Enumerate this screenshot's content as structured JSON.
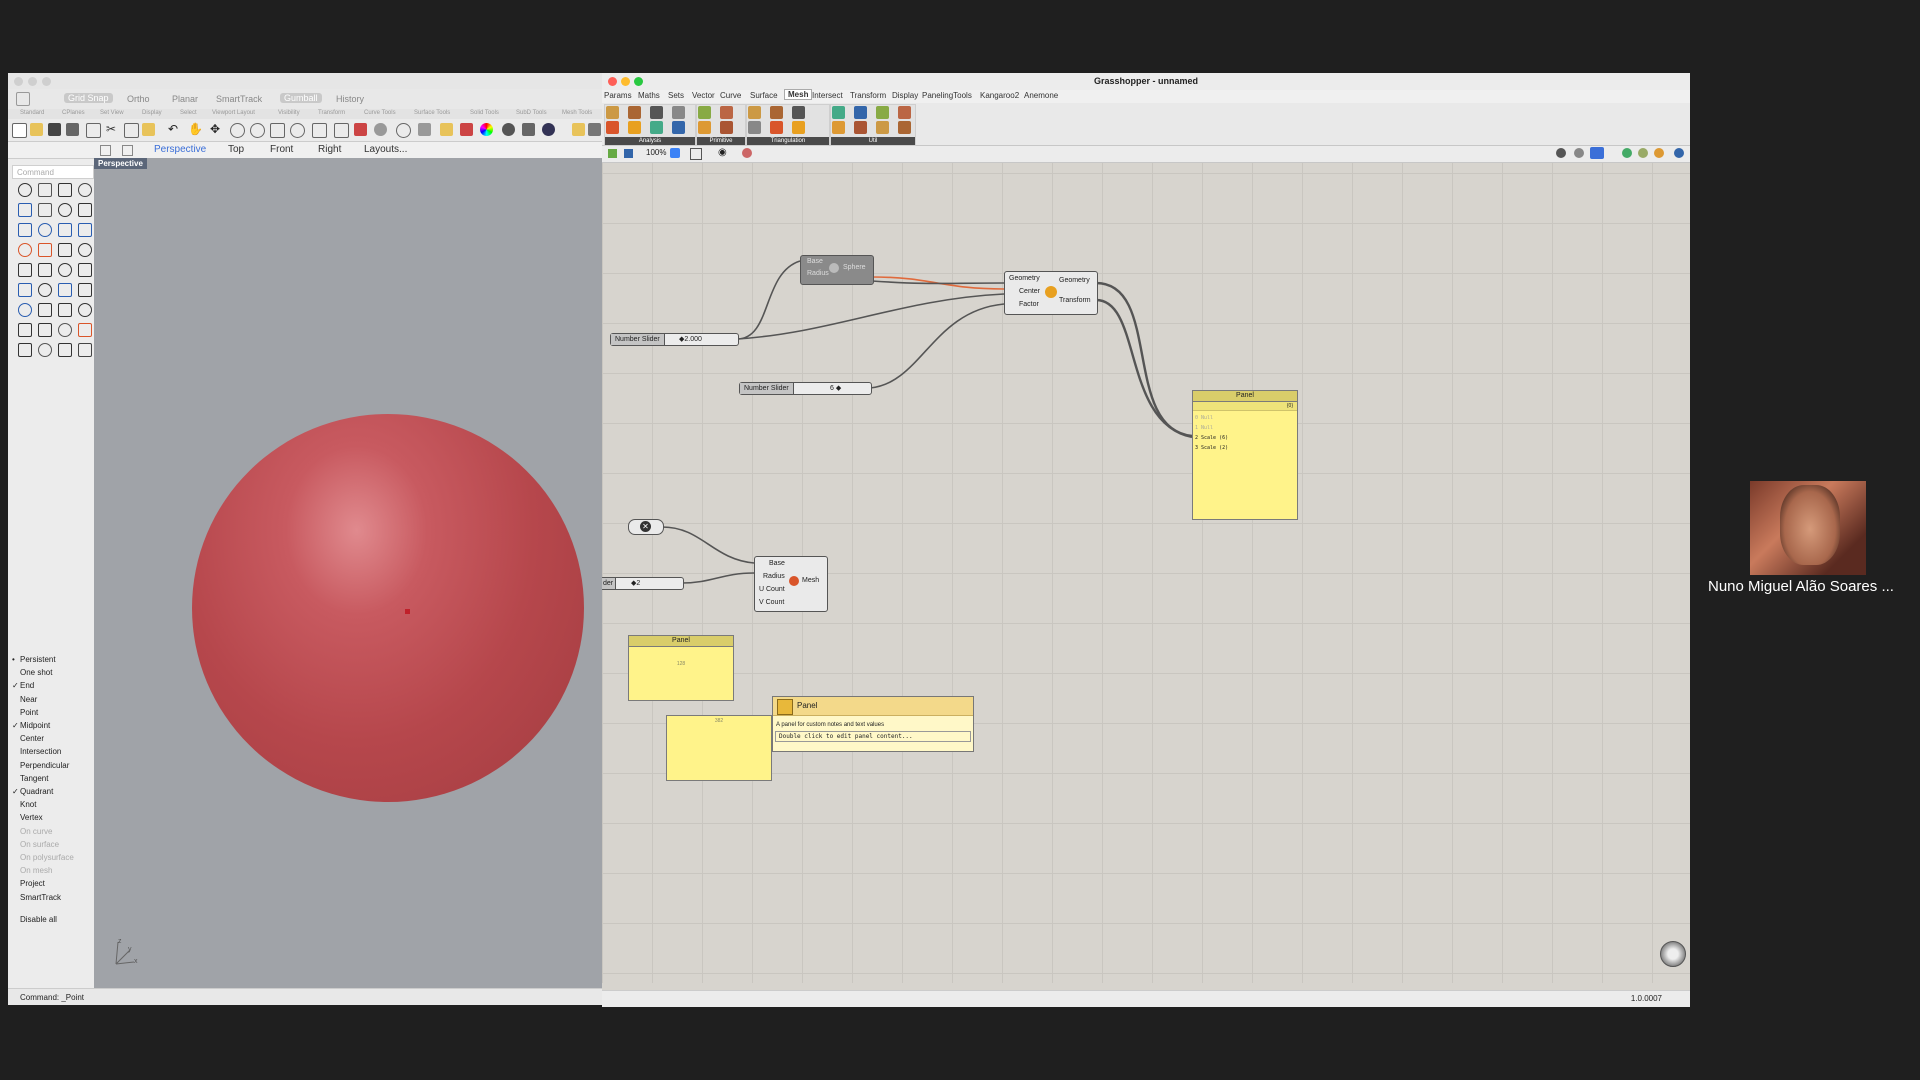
{
  "rhino": {
    "top_tabs": [
      "Grid Snap",
      "Ortho",
      "Planar",
      "SmartTrack",
      "Gumball",
      "History"
    ],
    "active_tabs": [
      "Grid Snap",
      "Gumball"
    ],
    "sub_tabs": [
      "Standard",
      "CPlanes",
      "Set View",
      "Display",
      "Select",
      "Viewport Layout",
      "Visibility",
      "Transform",
      "Curve Tools",
      "Surface Tools",
      "Solid Tools",
      "SubD Tools",
      "Mesh Tools"
    ],
    "view_tabs": [
      "Perspective",
      "Top",
      "Front",
      "Right",
      "Layouts..."
    ],
    "active_view": "Perspective",
    "command_placeholder": "Command",
    "viewport_label": "Perspective",
    "osnaps": [
      {
        "label": "Persistent",
        "mark": "•",
        "dim": false
      },
      {
        "label": "One shot",
        "mark": "",
        "dim": false
      },
      {
        "label": "End",
        "mark": "✓",
        "dim": false
      },
      {
        "label": "Near",
        "mark": "",
        "dim": false
      },
      {
        "label": "Point",
        "mark": "",
        "dim": false
      },
      {
        "label": "Midpoint",
        "mark": "✓",
        "dim": false
      },
      {
        "label": "Center",
        "mark": "",
        "dim": false
      },
      {
        "label": "Intersection",
        "mark": "",
        "dim": false
      },
      {
        "label": "Perpendicular",
        "mark": "",
        "dim": false
      },
      {
        "label": "Tangent",
        "mark": "",
        "dim": false
      },
      {
        "label": "Quadrant",
        "mark": "✓",
        "dim": false
      },
      {
        "label": "Knot",
        "mark": "",
        "dim": false
      },
      {
        "label": "Vertex",
        "mark": "",
        "dim": false
      },
      {
        "label": "On curve",
        "mark": "",
        "dim": true
      },
      {
        "label": "On surface",
        "mark": "",
        "dim": true
      },
      {
        "label": "On polysurface",
        "mark": "",
        "dim": true
      },
      {
        "label": "On mesh",
        "mark": "",
        "dim": true
      },
      {
        "label": "Project",
        "mark": "",
        "dim": false
      },
      {
        "label": "SmartTrack",
        "mark": "",
        "dim": false
      },
      {
        "label": "Disable all",
        "mark": "",
        "dim": false
      }
    ],
    "axis_labels": {
      "z": "z",
      "y": "y",
      "x": "x"
    },
    "status": "Command: _Point"
  },
  "grasshopper": {
    "title": "Grasshopper - unnamed",
    "menu": [
      "Params",
      "Maths",
      "Sets",
      "Vector",
      "Curve",
      "Surface",
      "Mesh",
      "Intersect",
      "Transform",
      "Display",
      "PanelingTools",
      "Kangaroo2",
      "Anemone"
    ],
    "active_menu": "Mesh",
    "ribbon_groups": [
      "Analysis",
      "Primitive",
      "Triangulation",
      "Util"
    ],
    "zoom": "100%",
    "components": {
      "sphere": {
        "inputs": [
          "Base",
          "Radius"
        ],
        "icon_label": "Sphere"
      },
      "scale": {
        "inputs": [
          "Geometry",
          "Center",
          "Factor"
        ],
        "outputs": [
          "Geometry",
          "Transform"
        ]
      },
      "mesh_sphere": {
        "inputs": [
          "Base",
          "Radius",
          "U Count",
          "V Count"
        ],
        "outputs": [
          "Mesh"
        ]
      }
    },
    "sliders": [
      {
        "name": "Number Slider",
        "value": "◆2.000"
      },
      {
        "name": "Number Slider",
        "value": "6 ◆"
      },
      {
        "name": "der",
        "value": "◆2"
      }
    ],
    "panel_main": {
      "title": "Panel",
      "badge": "{0}",
      "lines": [
        "0 Null",
        "1 Null",
        "2 Scale (6)",
        "3 Scale (2)"
      ]
    },
    "panel_small": {
      "title": "Panel",
      "content": "128"
    },
    "panel_blank": {
      "content": "382"
    },
    "tooltip": {
      "title": "Panel",
      "description": "A panel for custom notes and text values",
      "hint": "Double click to edit panel content..."
    },
    "status_right": "1.0.0007"
  },
  "participant": {
    "name": "Nuno Miguel Alão Soares ..."
  }
}
